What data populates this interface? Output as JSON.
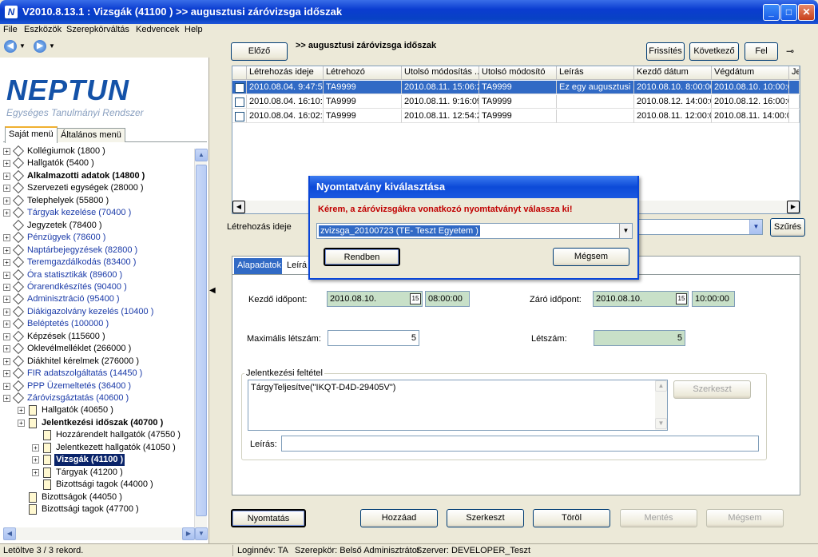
{
  "window": {
    "title": "V2010.8.13.1 : Vizsgák (41100 )  >> augusztusi záróvizsga időszak"
  },
  "menu": [
    "File",
    "Eszközök",
    "Szerepkörváltás",
    "Kedvencek",
    "Help"
  ],
  "logo": {
    "word": "NEPTUN",
    "subtitle": "Egységes Tanulmányi Rendszer"
  },
  "left_tabs": [
    "Saját menü",
    "Általános menü"
  ],
  "tree": [
    {
      "label": "Kollégiumok (1800  )",
      "level": 0,
      "exp": true,
      "style": ""
    },
    {
      "label": "Hallgatók (5400  )",
      "level": 0,
      "exp": true,
      "style": ""
    },
    {
      "label": "Alkalmazotti adatok (14800  )",
      "level": 0,
      "exp": true,
      "style": "bold"
    },
    {
      "label": "Szervezeti egységek (28000  )",
      "level": 0,
      "exp": true,
      "style": ""
    },
    {
      "label": "Telephelyek (55800  )",
      "level": 0,
      "exp": true,
      "style": ""
    },
    {
      "label": "Tárgyak kezelése (70400  )",
      "level": 0,
      "exp": true,
      "style": "blue"
    },
    {
      "label": "Jegyzetek (78400  )",
      "level": 0,
      "exp": false,
      "style": ""
    },
    {
      "label": "Pénzügyek (78600  )",
      "level": 0,
      "exp": true,
      "style": "blue"
    },
    {
      "label": "Naptárbejegyzések (82800  )",
      "level": 0,
      "exp": true,
      "style": "blue"
    },
    {
      "label": "Teremgazdálkodás (83400  )",
      "level": 0,
      "exp": true,
      "style": "blue"
    },
    {
      "label": "Óra statisztikák (89600  )",
      "level": 0,
      "exp": true,
      "style": "blue"
    },
    {
      "label": "Órarendkészítés (90400  )",
      "level": 0,
      "exp": true,
      "style": "blue"
    },
    {
      "label": "Adminisztráció (95400  )",
      "level": 0,
      "exp": true,
      "style": "blue"
    },
    {
      "label": "Diákigazolvány kezelés (10400  )",
      "level": 0,
      "exp": true,
      "style": "blue"
    },
    {
      "label": "Beléptetés (100000  )",
      "level": 0,
      "exp": true,
      "style": "blue"
    },
    {
      "label": "Képzések (115600  )",
      "level": 0,
      "exp": true,
      "style": ""
    },
    {
      "label": "Oklevélmelléklet (266000  )",
      "level": 0,
      "exp": true,
      "style": ""
    },
    {
      "label": "Diákhitel kérelmek (276000  )",
      "level": 0,
      "exp": true,
      "style": ""
    },
    {
      "label": "FIR adatszolgáltatás (14450  )",
      "level": 0,
      "exp": true,
      "style": "blue"
    },
    {
      "label": "PPP Üzemeltetés (36400  )",
      "level": 0,
      "exp": true,
      "style": "blue"
    },
    {
      "label": "Záróvizsgáztatás (40600  )",
      "level": 0,
      "exp": true,
      "style": "blue"
    },
    {
      "label": "Hallgatók (40650  )",
      "level": 1,
      "exp": true,
      "style": ""
    },
    {
      "label": "Jelentkezési időszak (40700  )",
      "level": 1,
      "exp": true,
      "style": "bold"
    },
    {
      "label": "Hozzárendelt hallgatók (47550  )",
      "level": 2,
      "exp": false,
      "style": ""
    },
    {
      "label": "Jelentkezett hallgatók (41050  )",
      "level": 2,
      "exp": true,
      "style": ""
    },
    {
      "label": "Vizsgák (41100  )",
      "level": 2,
      "exp": true,
      "style": "sel"
    },
    {
      "label": "Tárgyak (41200  )",
      "level": 2,
      "exp": true,
      "style": ""
    },
    {
      "label": "Bizottsági tagok (44000  )",
      "level": 2,
      "exp": false,
      "style": ""
    },
    {
      "label": "Bizottságok (44050  )",
      "level": 1,
      "exp": false,
      "style": ""
    },
    {
      "label": "Bizottsági tagok (47700  )",
      "level": 1,
      "exp": false,
      "style": ""
    }
  ],
  "toolbar": {
    "prev": "Előző",
    "heading": ">> augusztusi záróvizsga időszak",
    "refresh": "Frissítés",
    "next": "Következő",
    "up": "Fel"
  },
  "grid": {
    "columns": [
      "Létrehozás ideje",
      "Létrehozó",
      "Utolsó módosítás ...",
      "Utolsó módosító",
      "Leírás",
      "Kezdő dátum",
      "Végdátum",
      "Je"
    ],
    "rows": [
      [
        "2010.08.04. 9:47:50",
        "TA9999",
        "2010.08.11. 15:06:2",
        "TA9999",
        "Ez egy augusztusi zá",
        "2010.08.10. 8:00:00",
        "2010.08.10. 10:00:0",
        ""
      ],
      [
        "2010.08.04. 16:10:3",
        "TA9999",
        "2010.08.11. 9:16:09",
        "TA9999",
        "",
        "2010.08.12. 14:00:0",
        "2010.08.12. 16:00:0",
        ""
      ],
      [
        "2010.08.04. 16:02:2",
        "TA9999",
        "2010.08.11. 12:54:2",
        "TA9999",
        "",
        "2010.08.11. 12:00:0",
        "2010.08.11. 14:00:0",
        ""
      ]
    ]
  },
  "filter": {
    "label": "Létrehozás ideje",
    "button": "Szűrés"
  },
  "detail_tabs": [
    "Alapadatok",
    "Leírá"
  ],
  "form": {
    "start_label": "Kezdő időpont:",
    "start_date": "2010.08.10.",
    "start_time": "08:00:00",
    "end_label": "Záró időpont:",
    "end_date": "2010.08.10.",
    "end_time": "10:00:00",
    "max_label": "Maximális létszám:",
    "max_value": "5",
    "count_label": "Létszám:",
    "count_value": "5",
    "cond_title": "Jelentkezési feltétel",
    "cond_value": "TárgyTeljesítve(\"IKQT-D4D-29405V\")",
    "edit_button": "Szerkeszt",
    "desc_label": "Leírás:",
    "desc_value": "",
    "cal_icon": "15"
  },
  "bottom_buttons": {
    "print": "Nyomtatás",
    "add": "Hozzáad",
    "edit": "Szerkeszt",
    "delete": "Töröl",
    "save": "Mentés",
    "cancel": "Mégsem"
  },
  "dialog": {
    "title": "Nyomtatvány kiválasztása",
    "message": "Kérem, a záróvizsgákra vonatkozó nyomtatványt válassza ki!",
    "selected": "zvizsga_20100723  (TE- Teszt Egyetem )",
    "ok": "Rendben",
    "cancel": "Mégsem"
  },
  "status": {
    "records": "Letöltve 3 / 3 rekord.",
    "login": "Loginnév: TA",
    "role": "Szerepkör: Belső Adminisztrátor",
    "server": "Szerver: DEVELOPER_Teszt"
  },
  "colors": {
    "title": "#0a3cd0",
    "selection": "#316ac5",
    "tree_selection": "#0a246a",
    "error_text": "#c00000",
    "readonly_field": "#c8e0c8"
  }
}
